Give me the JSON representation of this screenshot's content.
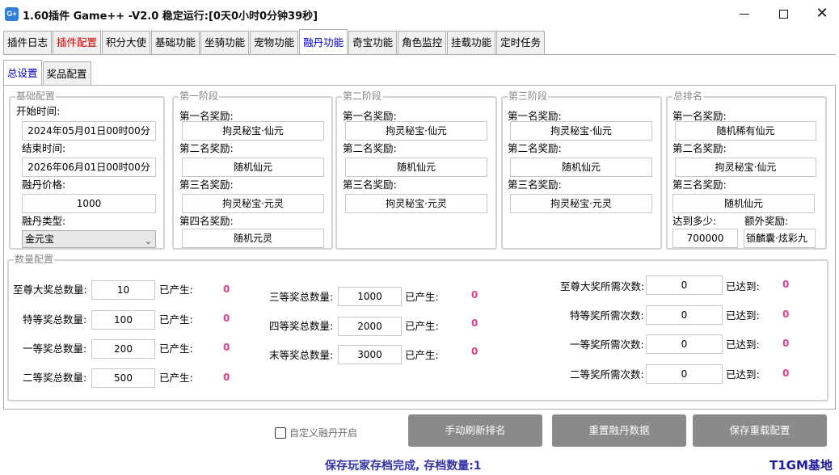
{
  "window": {
    "icon_text": "G+",
    "title": "1.60插件 Game++ -V2.0 稳定运行:[0天0小时0分钟39秒]"
  },
  "tabs": [
    {
      "label": "插件日志"
    },
    {
      "label": "插件配置"
    },
    {
      "label": "积分大使"
    },
    {
      "label": "基础功能"
    },
    {
      "label": "坐骑功能"
    },
    {
      "label": "宠物功能"
    },
    {
      "label": "融丹功能"
    },
    {
      "label": "奇宝功能"
    },
    {
      "label": "角色监控"
    },
    {
      "label": "挂载功能"
    },
    {
      "label": "定时任务"
    }
  ],
  "subtabs": [
    {
      "label": "总设置"
    },
    {
      "label": "奖品配置"
    }
  ],
  "basic": {
    "title": "基础配置",
    "start_label": "开始时间:",
    "start_value": "2024年05月01日00时00分",
    "end_label": "结束时间:",
    "end_value": "2026年06月01日00时00分",
    "price_label": "融丹价格:",
    "price_value": "1000",
    "type_label": "融丹类型:",
    "type_value": "金元宝"
  },
  "stage1": {
    "title": "第一阶段",
    "l1": "第一名奖励:",
    "v1": "拘灵秘宝·仙元",
    "l2": "第二名奖励:",
    "v2": "随机仙元",
    "l3": "第三名奖励:",
    "v3": "拘灵秘宝·元灵",
    "l4": "第四名奖励:",
    "v4": "随机元灵"
  },
  "stage2": {
    "title": "第二阶段",
    "l1": "第一名奖励:",
    "v1": "拘灵秘宝·仙元",
    "l2": "第二名奖励:",
    "v2": "随机仙元",
    "l3": "第三名奖励:",
    "v3": "拘灵秘宝·元灵"
  },
  "stage3": {
    "title": "第三阶段",
    "l1": "第一名奖励:",
    "v1": "拘灵秘宝·仙元",
    "l2": "第二名奖励:",
    "v2": "随机仙元",
    "l3": "第三名奖励:",
    "v3": "拘灵秘宝·元灵"
  },
  "total_rank": {
    "title": "总排名",
    "l1": "第一名奖励:",
    "v1": "随机稀有仙元",
    "l2": "第二名奖励:",
    "v2": "拘灵秘宝·仙元",
    "l3": "第三名奖励:",
    "v3": "随机仙元",
    "reach_label": "达到多少:",
    "reach_value": "700000",
    "extra_label": "额外奖励:",
    "extra_value": "锁麟囊·炫彩九"
  },
  "quantity": {
    "title": "数量配置",
    "produced_label": "已产生:",
    "reached_label": "已达到:",
    "left": [
      {
        "label": "至尊大奖总数量:",
        "value": "10",
        "count": "0"
      },
      {
        "label": "特等奖总数量:",
        "value": "100",
        "count": "0"
      },
      {
        "label": "一等奖总数量:",
        "value": "200",
        "count": "0"
      },
      {
        "label": "二等奖总数量:",
        "value": "500",
        "count": "0"
      }
    ],
    "middle": [
      {
        "label": "三等奖总数量:",
        "value": "1000",
        "count": "0"
      },
      {
        "label": "四等奖总数量:",
        "value": "2000",
        "count": "0"
      },
      {
        "label": "末等奖总数量:",
        "value": "3000",
        "count": "0"
      }
    ],
    "right": [
      {
        "label": "至尊大奖所需次数:",
        "value": "0",
        "count": "0"
      },
      {
        "label": "特等奖所需次数:",
        "value": "0",
        "count": "0"
      },
      {
        "label": "一等奖所需次数:",
        "value": "0",
        "count": "0"
      },
      {
        "label": "二等奖所需次数:",
        "value": "0",
        "count": "0"
      }
    ]
  },
  "custom_check_label": "自定义融丹开启",
  "buttons": {
    "refresh": "手动刷新排名",
    "reset": "重置融丹数据",
    "save": "保存重载配置"
  },
  "status": {
    "message": "保存玩家存档完成, 存档数量:1",
    "brand": "T1GM基地"
  },
  "colors": {
    "active_tab": "#0000c8",
    "warning_tab": "#d00000",
    "count": "#e0408a",
    "button_bg": "#8a8a8a",
    "status_text": "#3333aa"
  }
}
